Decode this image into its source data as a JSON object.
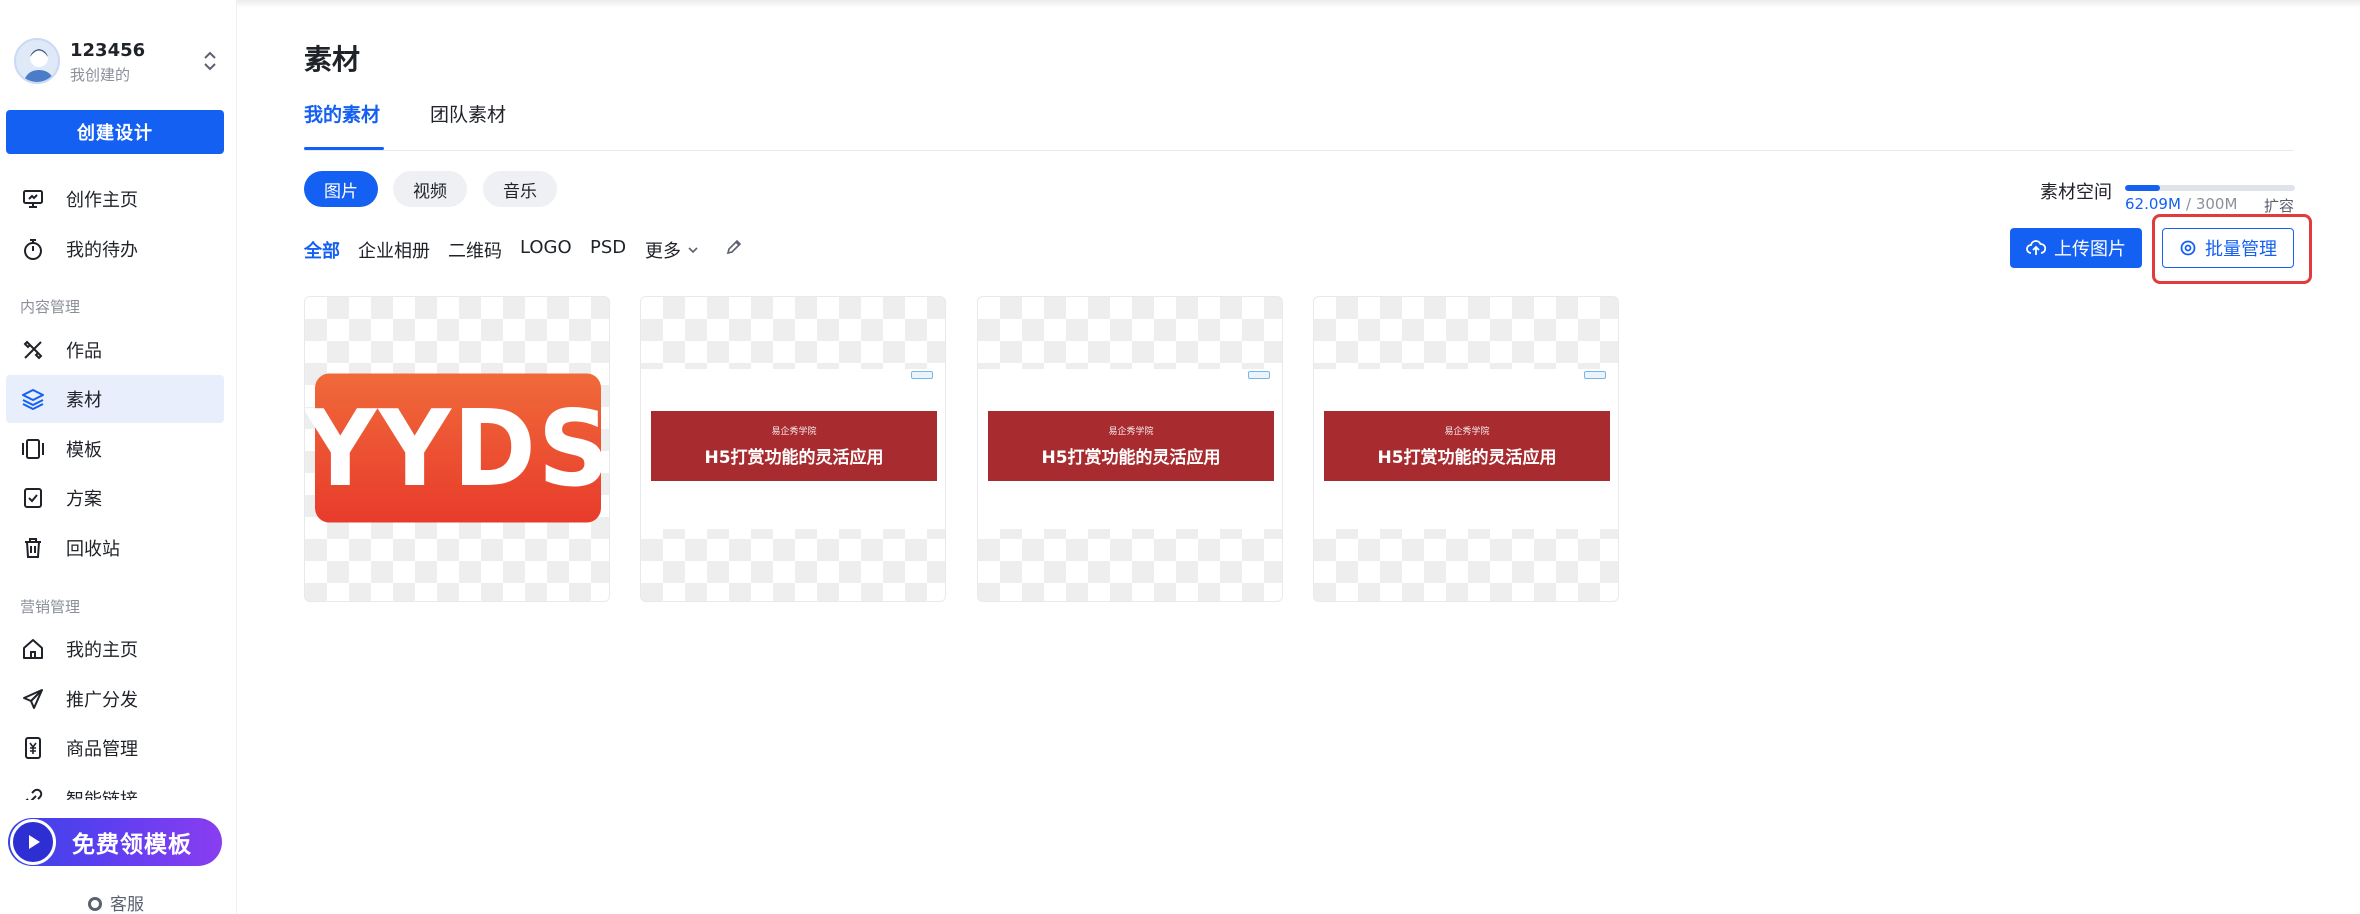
{
  "account": {
    "name": "123456",
    "subtitle": "我创建的"
  },
  "sidebar": {
    "create_label": "创建设计",
    "top_items": [
      {
        "label": "创作主页",
        "icon": "monitor-icon"
      },
      {
        "label": "我的待办",
        "icon": "stopwatch-icon"
      }
    ],
    "groups": [
      {
        "title": "内容管理",
        "items": [
          {
            "label": "作品",
            "icon": "tools-icon"
          },
          {
            "label": "素材",
            "icon": "layers-icon",
            "active": true
          },
          {
            "label": "模板",
            "icon": "carousel-icon"
          },
          {
            "label": "方案",
            "icon": "checklist-icon"
          },
          {
            "label": "回收站",
            "icon": "trash-icon"
          }
        ]
      },
      {
        "title": "营销管理",
        "items": [
          {
            "label": "我的主页",
            "icon": "home-icon"
          },
          {
            "label": "推广分发",
            "icon": "send-icon"
          },
          {
            "label": "商品管理",
            "icon": "product-icon"
          },
          {
            "label": "智能链接",
            "icon": "link-icon"
          }
        ]
      }
    ],
    "promo_label": "免费领模板",
    "service_label": "客服"
  },
  "main": {
    "title": "素材",
    "tabs": [
      {
        "label": "我的素材",
        "active": true
      },
      {
        "label": "团队素材"
      }
    ],
    "media_types": [
      {
        "label": "图片",
        "active": true
      },
      {
        "label": "视频"
      },
      {
        "label": "音乐"
      }
    ],
    "filters": [
      {
        "label": "全部",
        "active": true
      },
      {
        "label": "企业相册"
      },
      {
        "label": "二维码"
      },
      {
        "label": "LOGO"
      },
      {
        "label": "PSD"
      },
      {
        "label": "更多"
      }
    ],
    "storage": {
      "label": "素材空间",
      "used": "62.09M",
      "separator": "/",
      "total": "300M",
      "expand_label": "扩容",
      "used_fraction": 0.207
    },
    "upload_label": "上传图片",
    "batch_label": "批量管理",
    "thumbnails": [
      {
        "type": "text-logo",
        "text": "YYDS"
      },
      {
        "type": "banner",
        "sub": "易企秀学院",
        "title": "H5打赏功能的灵活应用"
      },
      {
        "type": "banner",
        "sub": "易企秀学院",
        "title": "H5打赏功能的灵活应用"
      },
      {
        "type": "banner",
        "sub": "易企秀学院",
        "title": "H5打赏功能的灵活应用"
      }
    ]
  },
  "colors": {
    "accent": "#1460f2",
    "highlight": "#e23b3b",
    "banner_red": "#a82b2f",
    "logo_orange": "#ee5a32"
  }
}
